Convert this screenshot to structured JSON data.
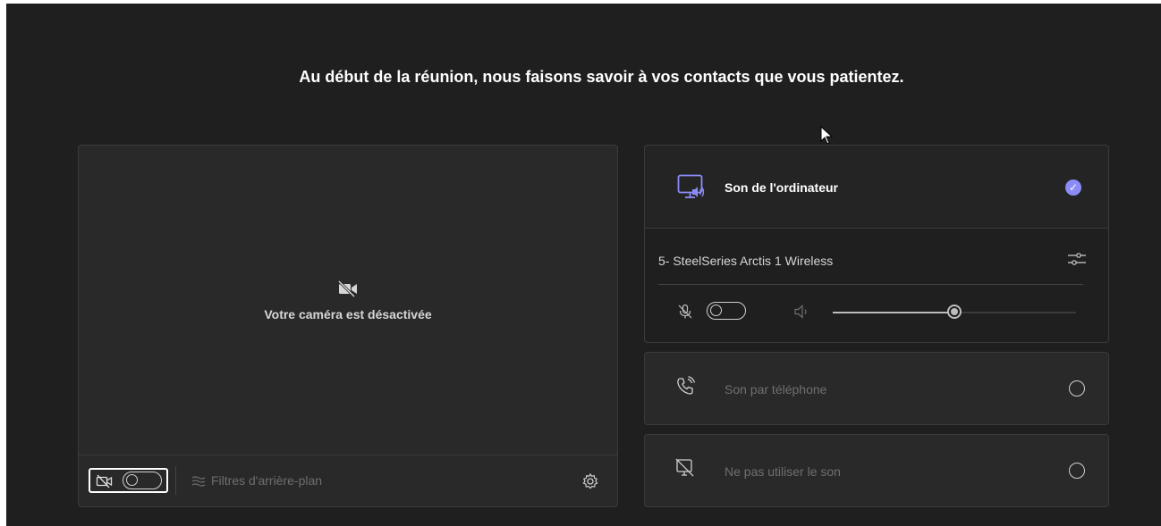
{
  "headline": "Au début de la réunion, nous faisons savoir à vos contacts que vous patientez.",
  "video": {
    "camera_off_text": "Votre caméra est désactivée",
    "camera_enabled": false,
    "background_filters_label": "Filtres d'arrière-plan"
  },
  "audio": {
    "options": [
      {
        "label": "Son de l'ordinateur",
        "selected": true,
        "icon": "computer-audio-icon"
      },
      {
        "label": "Son par téléphone",
        "selected": false,
        "icon": "phone-audio-icon"
      },
      {
        "label": "Ne pas utiliser le son",
        "selected": false,
        "icon": "no-audio-icon"
      }
    ],
    "device_name": "5- SteelSeries Arctis 1 Wireless",
    "mic_enabled": false,
    "volume_percent": 50
  },
  "colors": {
    "background": "#1f1f1f",
    "panel": "#292929",
    "accent": "#8b8cf7"
  }
}
